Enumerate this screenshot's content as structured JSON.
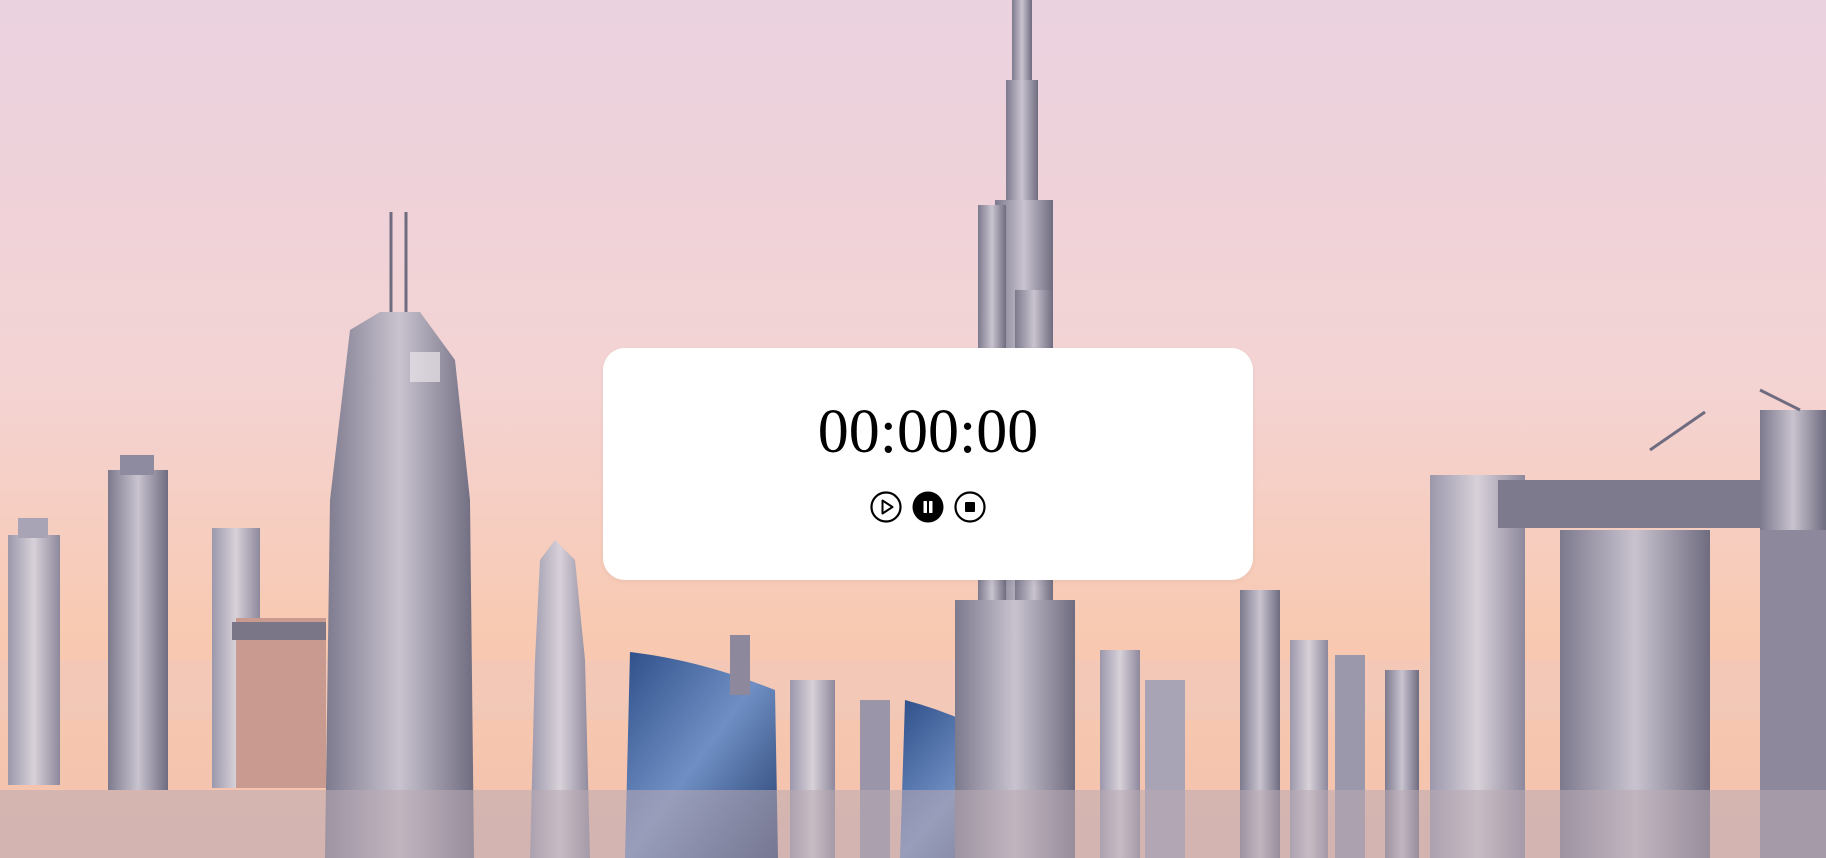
{
  "timer": {
    "display": "00:00:00"
  },
  "controls": {
    "play_icon": "play-circle-icon",
    "pause_icon": "pause-circle-fill-icon",
    "stop_icon": "stop-circle-icon"
  },
  "background": {
    "sky_top": "#ead2df",
    "sky_bottom": "#f9c7a8"
  }
}
